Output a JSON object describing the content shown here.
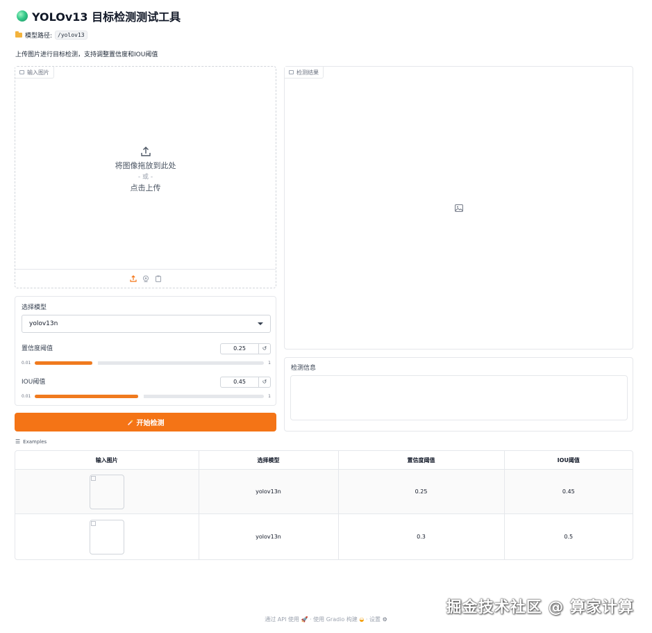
{
  "header": {
    "title": "YOLOv13 目标检测测试工具",
    "model_path_label": "模型路径:",
    "model_path_value": "/yolov13",
    "description": "上传图片进行目标检测，支持调整置信度和IOU阈值"
  },
  "input_panel": {
    "label": "输入图片",
    "drop_text": "将图像拖放到此处",
    "or_text": "- 或 -",
    "click_text": "点击上传"
  },
  "controls": {
    "model_label": "选择模型",
    "model_value": "yolov13n",
    "confidence": {
      "label": "置信度阈值",
      "value": "0.25",
      "min": "0.01",
      "max": "1",
      "fraction": 0.25
    },
    "iou": {
      "label": "IOU阈值",
      "value": "0.45",
      "min": "0.01",
      "max": "1",
      "fraction": 0.45
    },
    "reset_glyph": "↺"
  },
  "run_button": {
    "label": "开始检测",
    "icon": "magic-wand-icon"
  },
  "result_panel": {
    "label": "检测结果"
  },
  "info_panel": {
    "label": "检测信息",
    "value": ""
  },
  "examples": {
    "label": "Examples",
    "headers": [
      "输入图片",
      "选择模型",
      "置信度阈值",
      "IOU阈值"
    ],
    "rows": [
      {
        "model": "yolov13n",
        "conf": "0.25",
        "iou": "0.45"
      },
      {
        "model": "yolov13n",
        "conf": "0.3",
        "iou": "0.5"
      }
    ]
  },
  "watermark": "掘金技术社区 @ 算家计算",
  "footer": {
    "api": "通过 API 使用",
    "built": "使用 Gradio 构建",
    "settings": "设置",
    "sep": "·"
  },
  "colors": {
    "accent": "#f47416",
    "border": "#e5e7eb"
  }
}
